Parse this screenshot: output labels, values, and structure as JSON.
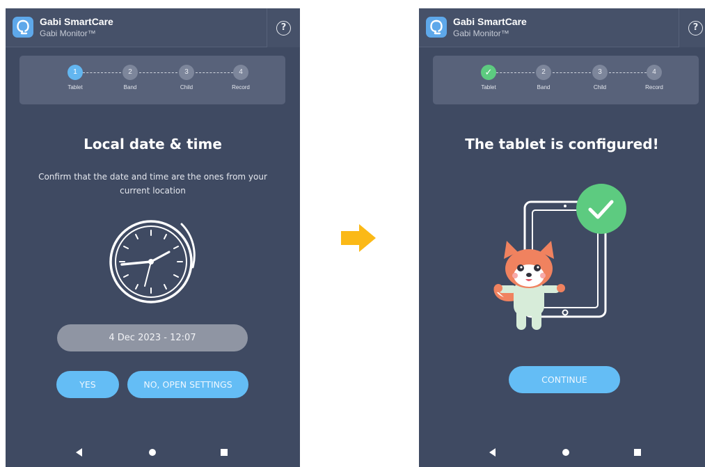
{
  "app": {
    "title": "Gabi SmartCare",
    "subtitle": "Gabi Monitor™",
    "help_icon": "question-circle-icon"
  },
  "steps": [
    {
      "number": "1",
      "label": "Tablet"
    },
    {
      "number": "2",
      "label": "Band"
    },
    {
      "number": "3",
      "label": "Child"
    },
    {
      "number": "4",
      "label": "Record"
    }
  ],
  "left_screen": {
    "current_step": "1",
    "heading": "Local date & time",
    "description": "Confirm that the date and time are the ones from your current location",
    "illustration": "clock-icon",
    "datetime": "4 Dec 2023 - 12:07",
    "yes_button": "YES",
    "settings_button": "NO, OPEN SETTINGS"
  },
  "transition": {
    "icon": "arrow-right-icon",
    "color": "#fbb917"
  },
  "right_screen": {
    "completed_step": "1",
    "step1_icon": "check-icon",
    "heading": "The tablet is configured!",
    "illustration": "tablet-with-fox-mascot-illustration",
    "continue_button": "CONTINUE"
  },
  "navbar": {
    "back": "back-icon",
    "home": "home-icon",
    "recents": "recents-icon"
  },
  "colors": {
    "background": "#3f4a62",
    "accent": "#64bdf5",
    "success": "#5dcb80",
    "step_inactive": "#7d869b"
  }
}
